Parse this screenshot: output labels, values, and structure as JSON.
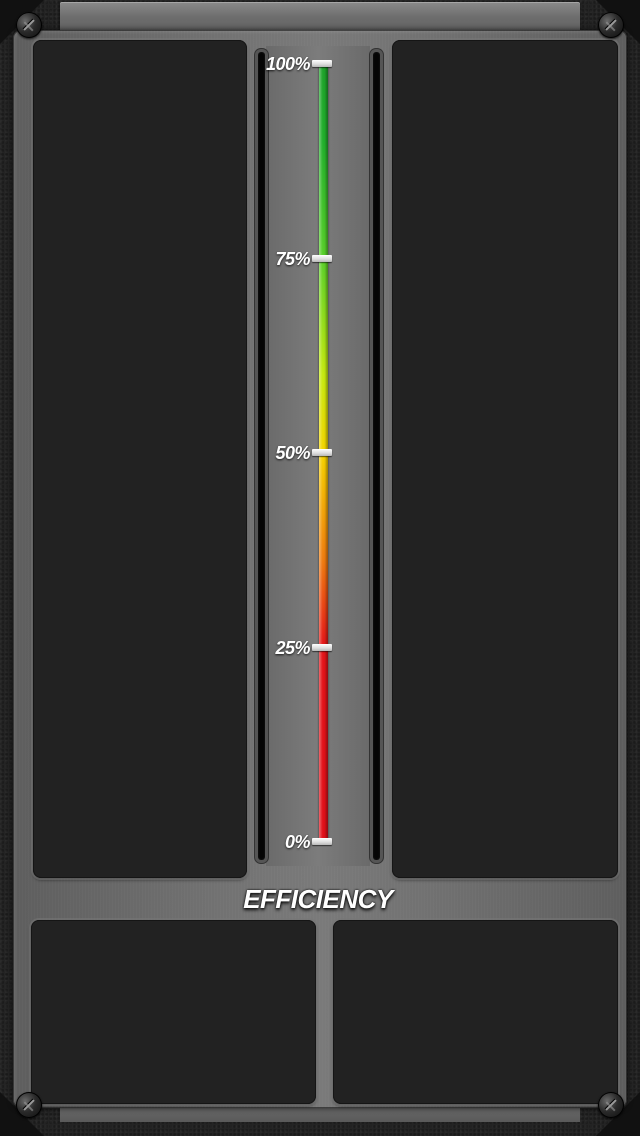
{
  "gauge": {
    "title": "EFFICIENCY",
    "ticks": [
      {
        "label": "100%",
        "value": 100
      },
      {
        "label": "75%",
        "value": 75
      },
      {
        "label": "50%",
        "value": 50
      },
      {
        "label": "25%",
        "value": 25
      },
      {
        "label": "0%",
        "value": 0
      }
    ],
    "colors": {
      "high": "#1ea22a",
      "mid": "#f5d400",
      "low": "#e0101a"
    }
  },
  "panels": {
    "top_left": {
      "text": ""
    },
    "top_right": {
      "text": ""
    },
    "bottom_left": {
      "text": ""
    },
    "bottom_right": {
      "text": ""
    }
  }
}
